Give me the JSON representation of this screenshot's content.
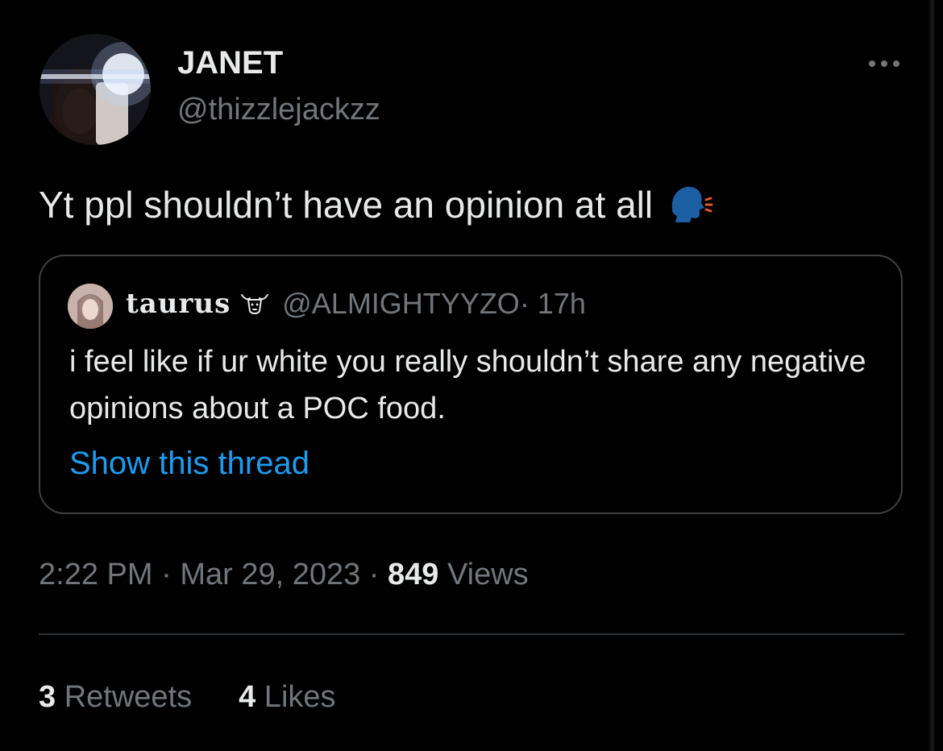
{
  "tweet": {
    "author": {
      "name": "JANET",
      "handle": "@thizzlejackzz"
    },
    "text": "Yt ppl shouldn’t have an opinion at all",
    "emoji": "speaking-head-icon",
    "quoted": {
      "name": "taurus",
      "handle": "@ALMIGHTYYZO",
      "time": " · 17h",
      "text": "i feel like if ur white you really shouldn’t share any negative opinions about a POC food.",
      "show_thread": "Show this thread"
    },
    "meta": {
      "time": "2:22 PM",
      "sep1": " · ",
      "date": "Mar 29, 2023",
      "sep2": " · ",
      "views_count": "849",
      "views_label": " Views"
    },
    "stats": {
      "retweets_count": "3",
      "retweets_label": " Retweets",
      "likes_count": "4",
      "likes_label": " Likes"
    }
  },
  "colors": {
    "background": "#000000",
    "text": "#e7e9ea",
    "secondary": "#71767b",
    "link": "#1d9bf0",
    "border": "#3e4144"
  }
}
